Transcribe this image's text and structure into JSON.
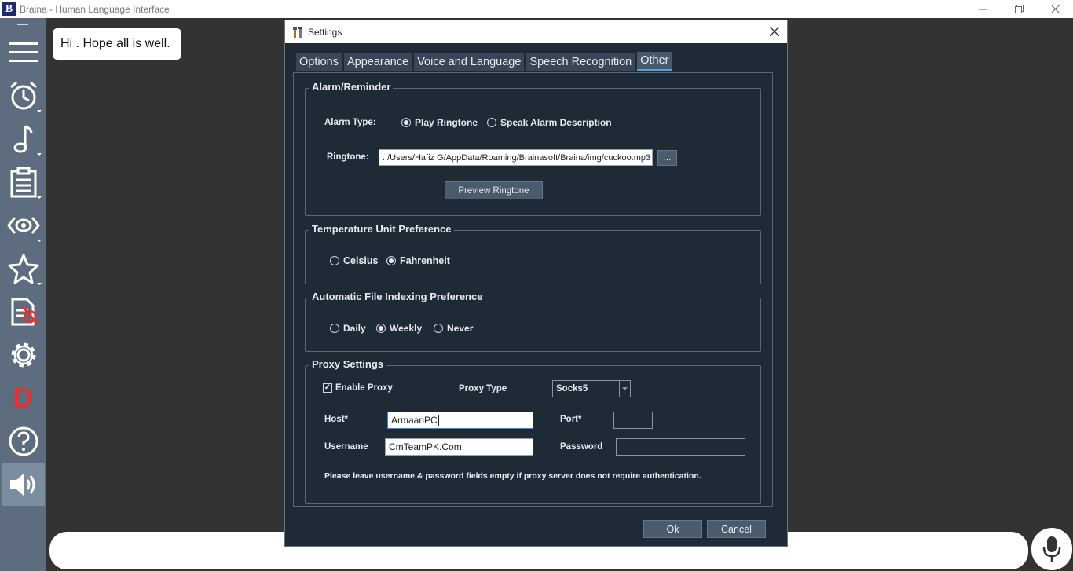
{
  "window": {
    "logo_letter": "B",
    "title": "Braina - Human Language Interface"
  },
  "sidebar": {
    "items": [
      {
        "icon": "menu-icon"
      },
      {
        "icon": "alarm-clock-icon"
      },
      {
        "icon": "music-note-icon"
      },
      {
        "icon": "notes-icon"
      },
      {
        "icon": "code-eye-icon"
      },
      {
        "icon": "star-icon"
      },
      {
        "icon": "file-off-icon"
      },
      {
        "icon": "gear-icon"
      },
      {
        "icon": "d-letter-icon",
        "label": "D",
        "color": "#e0332e"
      },
      {
        "icon": "help-icon"
      },
      {
        "icon": "speaker-icon",
        "active": true
      }
    ]
  },
  "chat": {
    "message": "Hi . Hope all is well."
  },
  "dialog": {
    "title": "Settings",
    "tabs": [
      "Options",
      "Appearance",
      "Voice and Language",
      "Speech Recognition",
      "Other"
    ],
    "active_tab": "Other",
    "alarm": {
      "group_label": "Alarm/Reminder",
      "type_label": "Alarm Type:",
      "option_ringtone": "Play Ringtone",
      "option_speak": "Speak Alarm Description",
      "selected": "Play Ringtone",
      "ringtone_label": "Ringtone:",
      "ringtone_value": "::/Users/Hafiz G/AppData/Roaming/Brainasoft/Braina/img/cuckoo.mp3",
      "browse_label": "...",
      "preview_label": "Preview Ringtone"
    },
    "temperature": {
      "group_label": "Temperature Unit Preference",
      "option_celsius": "Celsius",
      "option_fahrenheit": "Fahrenheit",
      "selected": "Fahrenheit"
    },
    "indexing": {
      "group_label": "Automatic File Indexing Preference",
      "option_daily": "Daily",
      "option_weekly": "Weekly",
      "option_never": "Never",
      "selected": "Weekly"
    },
    "proxy": {
      "group_label": "Proxy Settings",
      "enable_label": "Enable Proxy",
      "enabled": true,
      "type_label": "Proxy Type",
      "type_value": "Socks5",
      "host_label": "Host*",
      "host_value": "ArmaanPC",
      "port_label": "Port*",
      "port_value": "",
      "username_label": "Username",
      "username_value": "CmTeamPK.Com",
      "password_label": "Password",
      "password_value": "",
      "note": "Please leave username & password fields empty if proxy server does not require authentication."
    },
    "ok_label": "Ok",
    "cancel_label": "Cancel"
  },
  "colors": {
    "sidebar": "#5d6c7e",
    "dialog_bg": "#1f2a37",
    "tab_accent": "#5aa0e6"
  }
}
